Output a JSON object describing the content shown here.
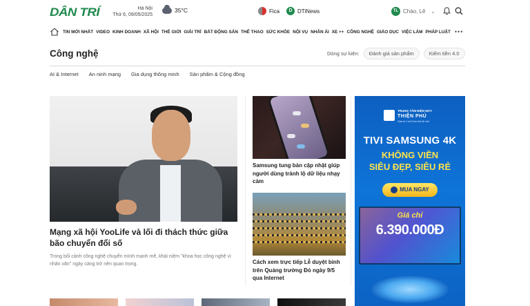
{
  "header": {
    "logo_text": "DÂN TRÍ",
    "location": {
      "city": "Hà Nội",
      "date": "Thứ 6, 09/05/2025"
    },
    "weather": {
      "icon": "cloud-icon",
      "temp": "35°C"
    },
    "brands": [
      {
        "label": "Fica",
        "icon": "fica-logo-icon"
      },
      {
        "label": "DTiNews",
        "icon": "dtinews-logo-icon"
      }
    ],
    "user": {
      "initials": "TL",
      "greeting": "Chào, Lê"
    }
  },
  "nav": {
    "items": [
      "TIN MỚI NHẤT",
      "VIDEO",
      "KINH DOANH",
      "XÃ HỘI",
      "THẾ GIỚI",
      "GIẢI TRÍ",
      "BẤT ĐỘNG SẢN",
      "THỂ THAO",
      "SỨC KHỎE",
      "NỘI VỤ",
      "NHÂN ÁI",
      "XE ++",
      "CÔNG NGHỆ",
      "GIÁO DỤC",
      "VIỆC LÀM",
      "PHÁP LUẬT"
    ],
    "more": "•••"
  },
  "section": {
    "title": "Công nghệ",
    "events_label": "Dòng sự kiện:",
    "events": [
      "Đánh giá sản phẩm",
      "Kiếm tiền 4.0"
    ],
    "subnav": [
      "AI & Internet",
      "An ninh mạng",
      "Gia dụng thông minh",
      "Sản phẩm & Cộng đồng"
    ]
  },
  "lead": {
    "title": "Mạng xã hội YooLife và lối đi thách thức giữa bão chuyển đổi số",
    "desc": "Trong bối cảnh công nghệ chuyển mình mạnh mẽ, khái niệm \"khoa học công nghệ vì nhân văn\" ngày càng trở nên quan trọng."
  },
  "side": [
    {
      "title": "Samsung tung bản cập nhật giúp người dùng tránh lộ dữ liệu nhạy cảm"
    },
    {
      "title": "Cách xem trực tiếp Lễ duyệt binh trên Quảng trường Đỏ ngày 9/5 qua Internet"
    }
  ],
  "ad": {
    "store_small": "TRUNG TÂM ĐIỆN MÁY",
    "store_name": "THIỆN PHÚ",
    "store_tag": "Giao từ 1 tới 5 km thế hệ mới",
    "headline": "TIVI SAMSUNG 4K",
    "line2": "KHÔNG VIỀN",
    "line3": "SIÊU ĐẸP, SIÊU RẺ",
    "button": "MUA NGAY",
    "price_label": "Giá chỉ",
    "price": "6.390.000Đ"
  }
}
